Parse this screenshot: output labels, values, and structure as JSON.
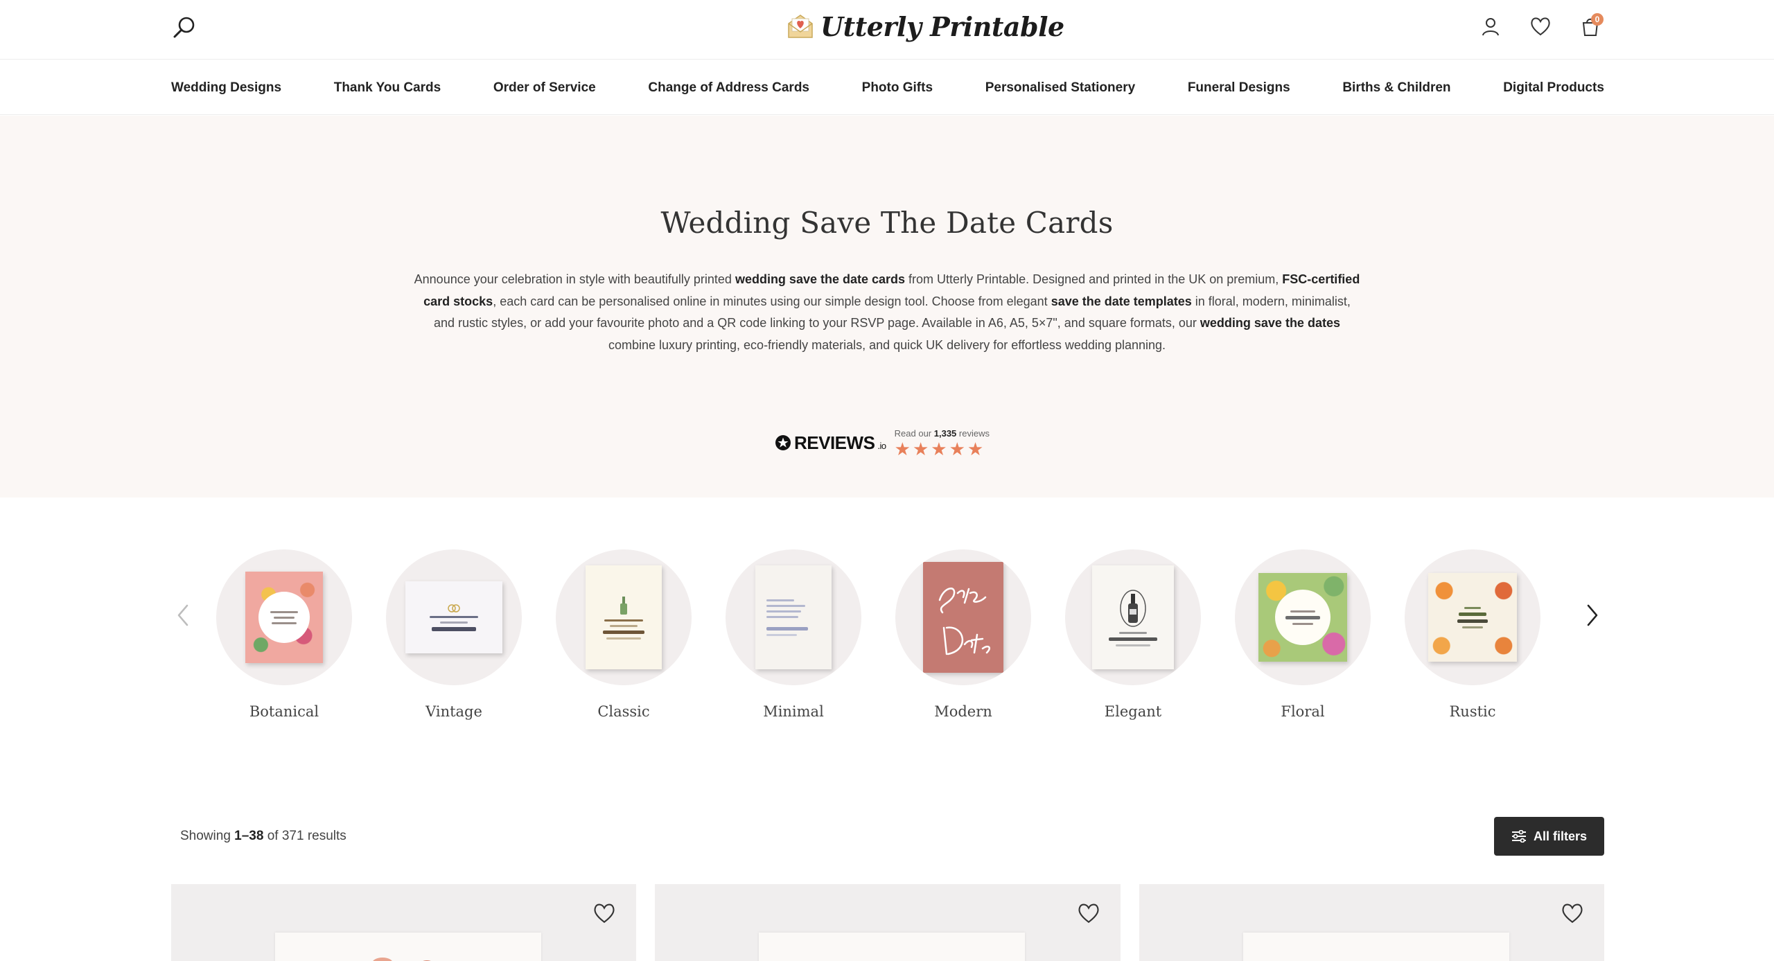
{
  "header": {
    "logo_text": "Utterly Printable",
    "icons": [
      "search-icon",
      "user-icon",
      "heart-icon",
      "basket-icon"
    ],
    "cart_count": "0"
  },
  "nav": {
    "items": [
      {
        "label": "Wedding Designs"
      },
      {
        "label": "Thank You Cards"
      },
      {
        "label": "Order of Service"
      },
      {
        "label": "Change of Address Cards"
      },
      {
        "label": "Photo Gifts"
      },
      {
        "label": "Personalised Stationery"
      },
      {
        "label": "Funeral Designs"
      },
      {
        "label": "Births & Children"
      },
      {
        "label": "Digital Products"
      }
    ]
  },
  "hero": {
    "title": "Wedding Save The Date Cards",
    "description": {
      "p1": "Announce your celebration in style with beautifully printed ",
      "b1": "wedding save the date cards",
      "p2": " from Utterly Printable. Designed and printed in the UK on premium, ",
      "b2": "FSC-certified card stocks",
      "p3": ", each card can be personalised online in minutes using our simple design tool. Choose from elegant ",
      "b3": "save the date templates",
      "p4": " in floral, modern, minimalist, and rustic styles, or add your favourite photo and a QR code linking to your RSVP page. Available in A6, A5, 5×7\", and square formats, our ",
      "b4": "wedding save the dates",
      "p5": " combine luxury printing, eco-friendly materials, and quick UK delivery for effortless wedding planning."
    },
    "reviews": {
      "brand": "REVIEWS",
      "brand_suffix": ".io",
      "prefix": "Read our ",
      "count": "1,335",
      "suffix": " reviews",
      "rating": 5
    }
  },
  "categories": {
    "items": [
      {
        "label": "Botanical",
        "bg": "#e9a58f"
      },
      {
        "label": "Vintage",
        "bg": "#f7f5f8"
      },
      {
        "label": "Classic",
        "bg": "#faf6ea"
      },
      {
        "label": "Minimal",
        "bg": "#f6f3ef"
      },
      {
        "label": "Modern",
        "bg": "#c47a72"
      },
      {
        "label": "Elegant",
        "bg": "#f8f6f2"
      },
      {
        "label": "Floral",
        "bg": "#c9d98f"
      },
      {
        "label": "Rustic",
        "bg": "#f5efe6"
      }
    ]
  },
  "results": {
    "prefix": "Showing ",
    "range": "1–38",
    "suffix": " of 371 results",
    "filters_label": "All filters"
  },
  "colors": {
    "hero_bg": "#fbf7f5",
    "accent": "#e8805a",
    "button_dark": "#2c2c2c"
  }
}
